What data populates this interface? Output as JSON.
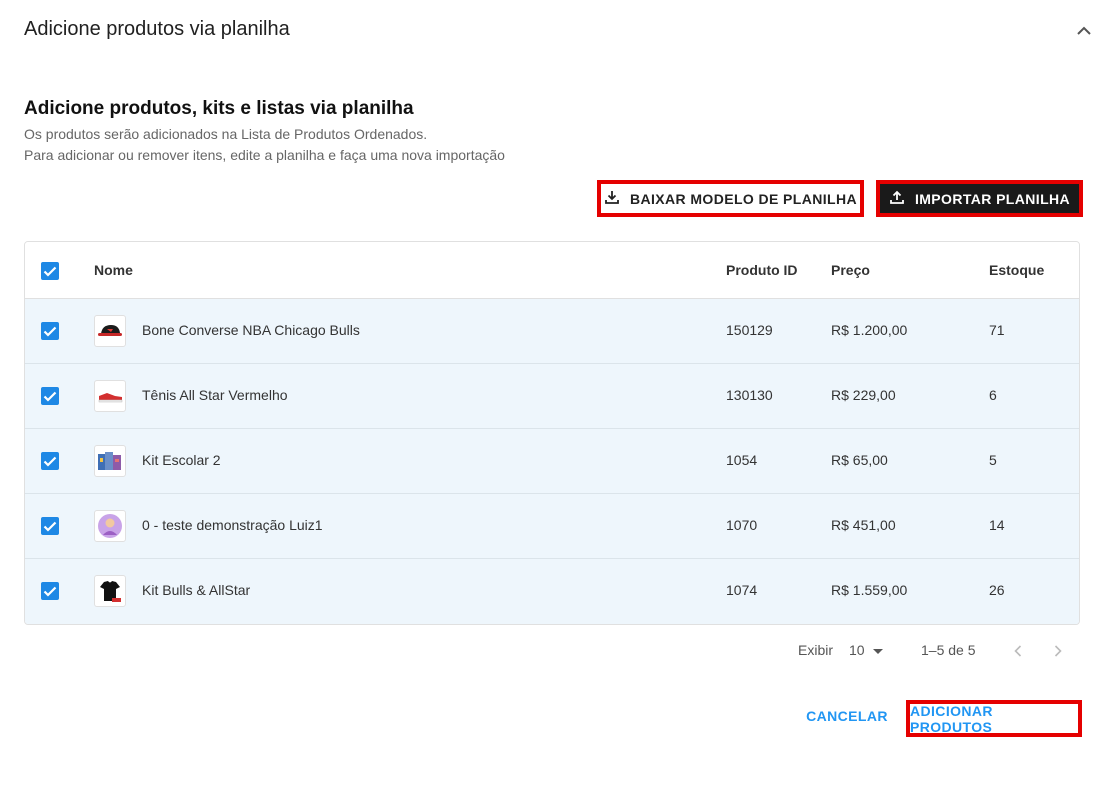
{
  "header": {
    "title": "Adicione produtos via planilha",
    "collapse_icon": "chevron-up-icon"
  },
  "section": {
    "title": "Adicione produtos, kits e listas via planilha",
    "desc1": "Os produtos serão adicionados na Lista de Produtos Ordenados.",
    "desc2": "Para adicionar ou remover itens, edite a planilha e faça uma nova importação"
  },
  "actions": {
    "download_label": "BAIXAR MODELO DE PLANILHA",
    "download_icon": "download-icon",
    "import_label": "IMPORTAR PLANILHA",
    "import_icon": "upload-icon"
  },
  "table": {
    "columns": {
      "name": "Nome",
      "id": "Produto ID",
      "price": "Preço",
      "stock": "Estoque"
    },
    "select_all_checked": true,
    "rows": [
      {
        "name": "Bone Converse NBA Chicago Bulls",
        "id": "150129",
        "price": "R$ 1.200,00",
        "stock": "71",
        "checked": true,
        "thumb": "cap-icon"
      },
      {
        "name": "Tênis All Star Vermelho",
        "id": "130130",
        "price": "R$ 229,00",
        "stock": "6",
        "checked": true,
        "thumb": "sneaker-icon"
      },
      {
        "name": "Kit Escolar 2",
        "id": "1054",
        "price": "R$ 65,00",
        "stock": "5",
        "checked": true,
        "thumb": "school-kit-icon"
      },
      {
        "name": "0 - teste demonstração Luiz1",
        "id": "1070",
        "price": "R$ 451,00",
        "stock": "14",
        "checked": true,
        "thumb": "avatar-icon"
      },
      {
        "name": "Kit Bulls & AllStar",
        "id": "1074",
        "price": "R$ 1.559,00",
        "stock": "26",
        "checked": true,
        "thumb": "tshirt-icon"
      }
    ]
  },
  "pagination": {
    "rows_label": "Exibir",
    "rows_value": "10",
    "range": "1–5 de 5"
  },
  "footer": {
    "cancel_label": "CANCELAR",
    "add_label": "ADICIONAR PRODUTOS"
  },
  "colors": {
    "accent": "#2196f3",
    "checkbox": "#1e88e5",
    "highlight": "#e50000",
    "row_bg": "#eef6fc",
    "dark_button": "#1a1a1a"
  }
}
